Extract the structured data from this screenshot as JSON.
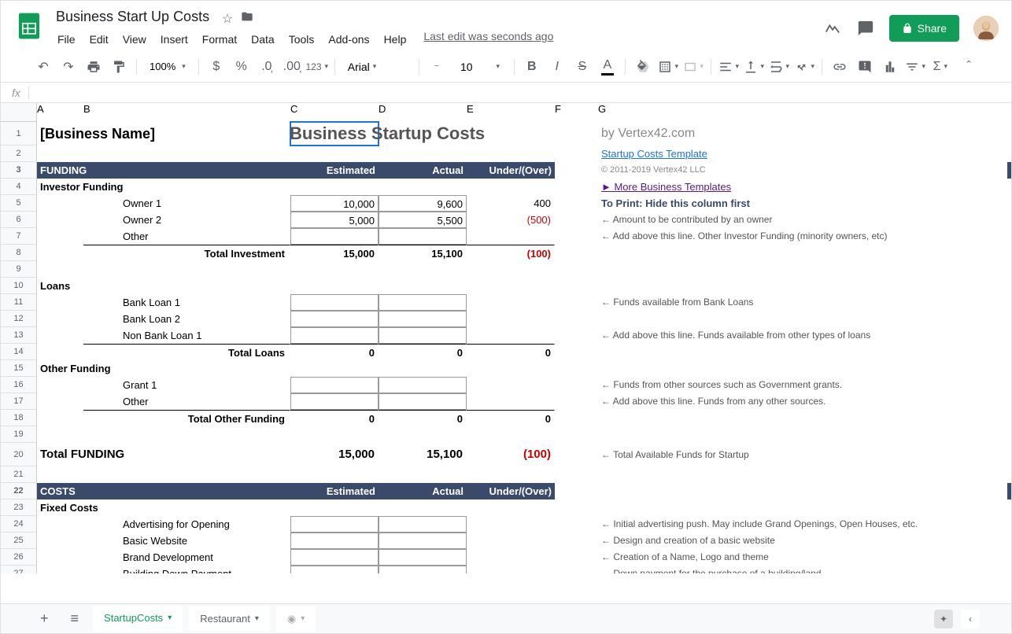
{
  "doc": {
    "title": "Business Start Up Costs",
    "edit_status": "Last edit was seconds ago"
  },
  "menu": {
    "file": "File",
    "edit": "Edit",
    "view": "View",
    "insert": "Insert",
    "format": "Format",
    "data": "Data",
    "tools": "Tools",
    "addons": "Add-ons",
    "help": "Help"
  },
  "toolbar": {
    "zoom": "100%",
    "font": "Arial",
    "size": "10",
    "fmt123": "123"
  },
  "share": {
    "label": "Share"
  },
  "sheets": {
    "tab1": "StartupCosts",
    "tab2": "Restaurant"
  },
  "content": {
    "biz_name": "[Business Name]",
    "title": "Business Startup Costs",
    "by_vertex": "by Vertex42.com",
    "template_link": "Startup Costs Template",
    "copyright": "© 2011-2019 Vertex42 LLC",
    "more_templates": "► More Business Templates",
    "print_note": "To Print: Hide this column first",
    "funding": "FUNDING",
    "estimated": "Estimated",
    "actual": "Actual",
    "under_over": "Under/(Over)",
    "investor_funding": "Investor Funding",
    "owner1": "Owner 1",
    "owner2": "Owner 2",
    "other": "Other",
    "total_investment": "Total Investment",
    "loans": "Loans",
    "bank_loan1": "Bank Loan 1",
    "bank_loan2": "Bank Loan 2",
    "non_bank_loan1": "Non Bank Loan 1",
    "total_loans": "Total Loans",
    "other_funding": "Other Funding",
    "grant1": "Grant 1",
    "total_other_funding": "Total Other Funding",
    "total_funding": "Total FUNDING",
    "costs": "COSTS",
    "fixed_costs": "Fixed Costs",
    "advertising": "Advertising for Opening",
    "basic_website": "Basic Website",
    "brand_dev": "Brand Development",
    "building_down": "Building Down Payment",
    "o1_est": "10,000",
    "o1_act": "9,600",
    "o1_diff": "400",
    "o2_est": "5,000",
    "o2_act": "5,500",
    "o2_diff": "(500)",
    "ti_est": "15,000",
    "ti_act": "15,100",
    "ti_diff": "(100)",
    "zero": "0",
    "tf_est": "15,000",
    "tf_act": "15,100",
    "tf_diff": "(100)",
    "n5": "← Amount to be contributed by an owner",
    "n7": "← Add above this line. Other Investor Funding (minority owners, etc)",
    "n11": "← Funds available from Bank Loans",
    "n13": "← Add above this line. Funds available from other types of loans",
    "n16": "← Funds from other sources such as Government grants.",
    "n17": "← Add above this line. Funds from any other sources.",
    "n20": "← Total Available Funds for Startup",
    "n24": "← Initial advertising push.  May include Grand Openings, Open Houses, etc.",
    "n25": "← Design and creation of a basic website",
    "n26": "← Creation of a Name, Logo and theme",
    "n27": "← Down payment for the purchase of a building/land"
  }
}
